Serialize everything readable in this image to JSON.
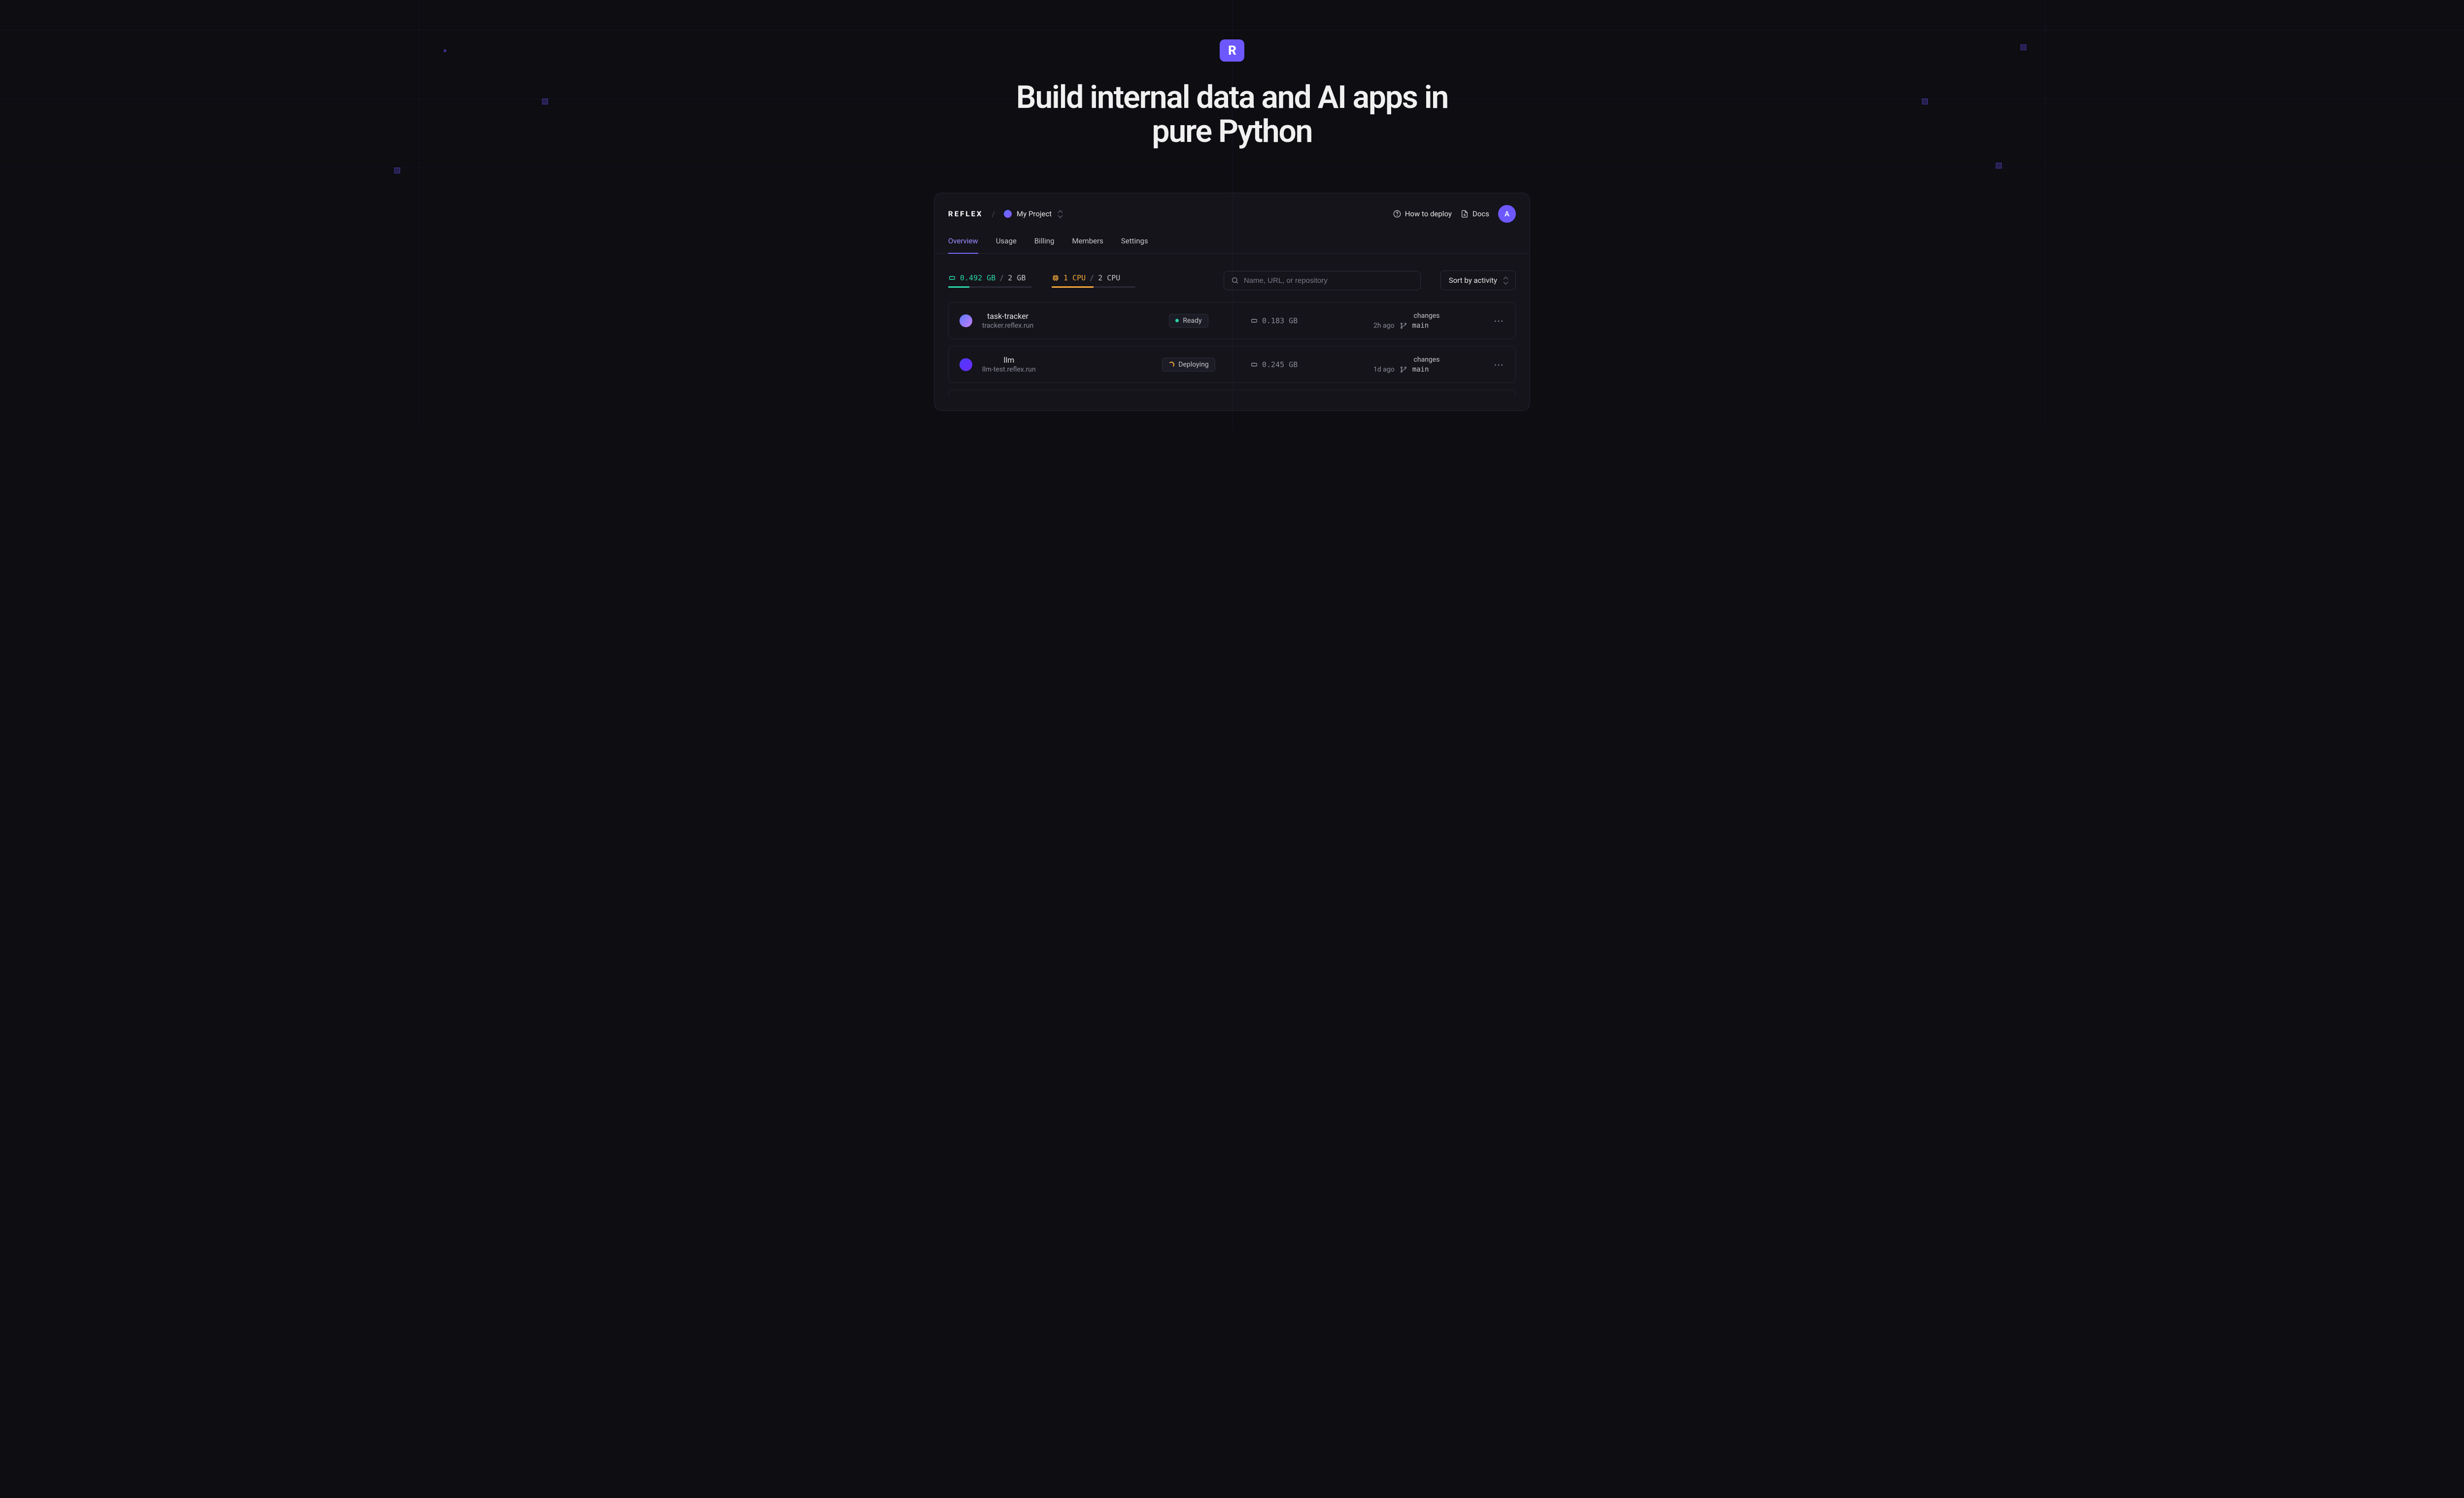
{
  "colors": {
    "accent": "#6d58ff",
    "mem": "#2bd4a7",
    "cpu": "#f0a53b"
  },
  "logo": {
    "letter": "R"
  },
  "tagline": "Build internal data and AI apps in pure Python",
  "header": {
    "brand": "REFLEX",
    "crumb_sep": "/",
    "project": "My Project",
    "how_to_deploy": "How to deploy",
    "docs": "Docs",
    "avatar_initial": "A"
  },
  "tabs": [
    "Overview",
    "Usage",
    "Billing",
    "Members",
    "Settings"
  ],
  "active_tab": "Overview",
  "usage": {
    "memory": {
      "used": "0.492 GB",
      "total": "2 GB"
    },
    "cpu": {
      "used": "1 CPU",
      "total": "2 CPU"
    }
  },
  "search": {
    "placeholder": "Name, URL, or repository"
  },
  "sort_label": "Sort by activity",
  "projects": [
    {
      "name": "task-tracker",
      "url": "tracker.reflex.run",
      "status": "Ready",
      "status_kind": "ready",
      "memory": "0.183 GB",
      "deploy_label": "changes",
      "deploy_time": "2h ago",
      "branch": "main",
      "dot_class": "v1"
    },
    {
      "name": "llm",
      "url": "llm-test.reflex.run",
      "status": "Deploying",
      "status_kind": "deploying",
      "memory": "0.245 GB",
      "deploy_label": "changes",
      "deploy_time": "1d ago",
      "branch": "main",
      "dot_class": "v2"
    }
  ]
}
